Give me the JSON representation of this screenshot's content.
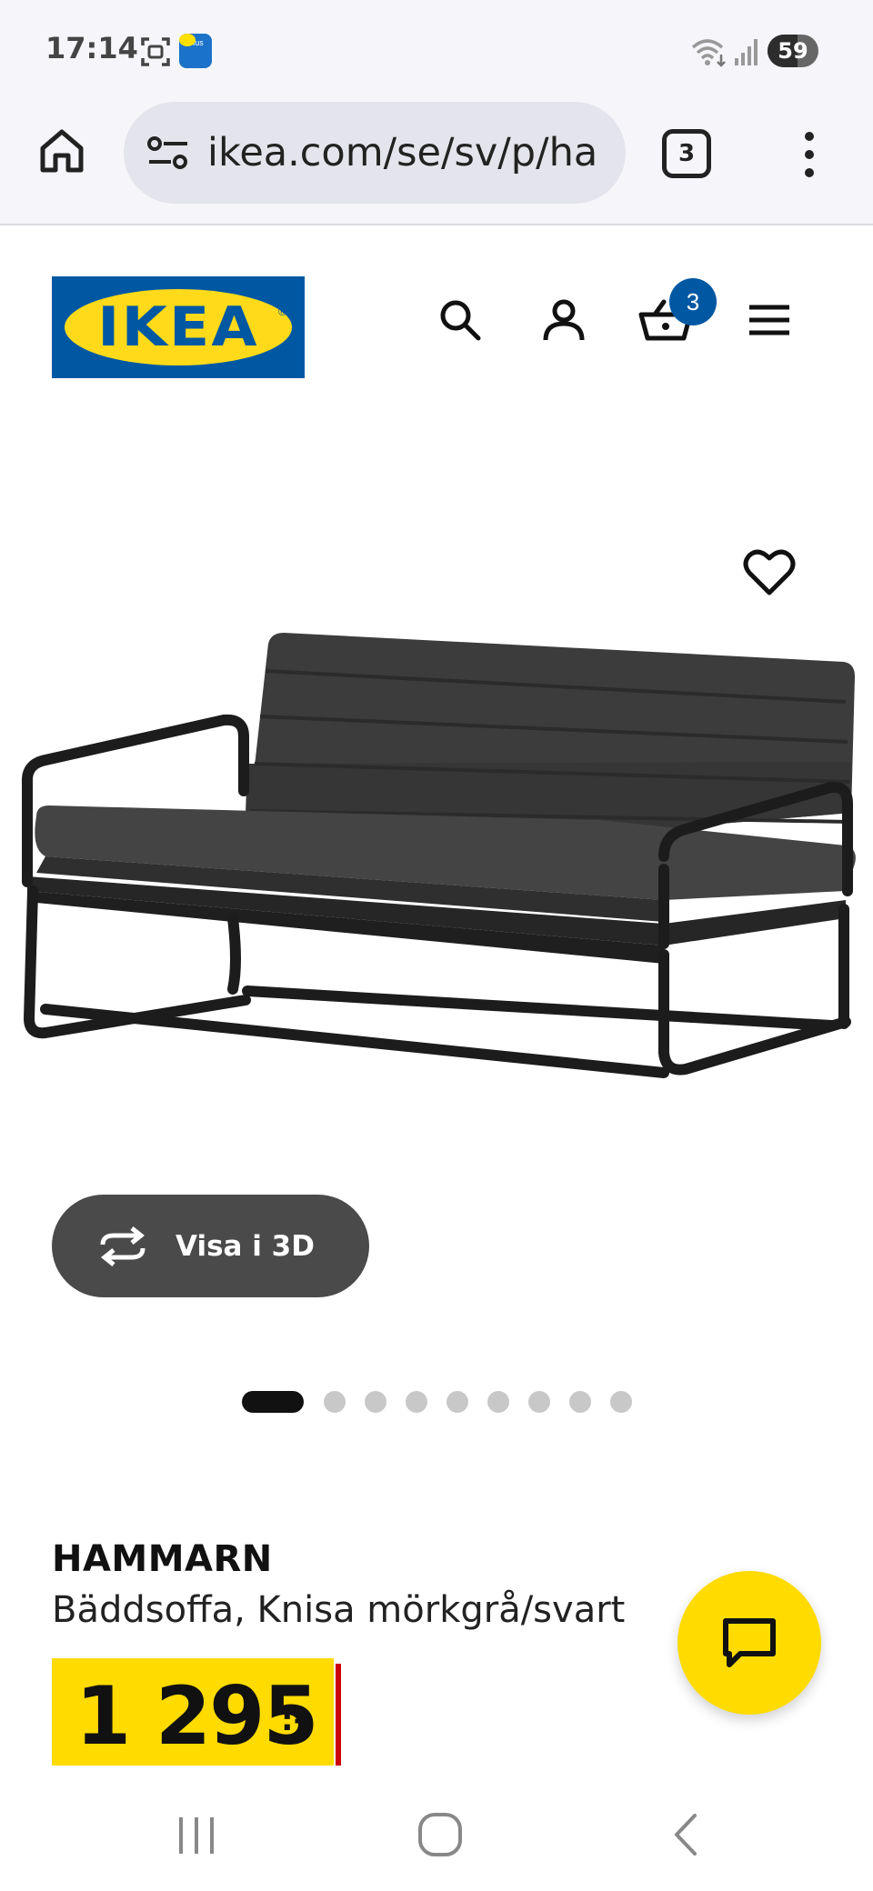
{
  "status_bar": {
    "time": "17:14",
    "battery_level": "59",
    "app_icon_label": "Plus",
    "icons": [
      "screenshot-icon",
      "app-icon",
      "wifi-icon",
      "signal-icon",
      "battery-icon"
    ]
  },
  "browser": {
    "url": "ikea.com/se/sv/p/ha",
    "tab_count": "3",
    "icons": [
      "home-icon",
      "tune-icon",
      "tabs-icon",
      "more-vert-icon"
    ]
  },
  "site_header": {
    "logo_text": "IKEA",
    "cart_count": "3",
    "brand_blue": "#0058a3",
    "brand_yellow": "#ffda1a",
    "icons": [
      "search-icon",
      "account-icon",
      "cart-icon",
      "hamburger-icon"
    ]
  },
  "product_media": {
    "view_3d_label": "Visa i 3D",
    "carousel_total": 9,
    "carousel_active": 1,
    "icons": [
      "heart-icon",
      "rotate-3d-icon"
    ]
  },
  "product": {
    "name": "HAMMARN",
    "description": "Bäddsoffa, Knisa mörkgrå/svart",
    "price_integer": "1 295",
    "price_suffix": ":-",
    "price_color": "#ffdb00"
  },
  "chat": {
    "icon": "chat-icon"
  },
  "nav_bar": {
    "icons": [
      "recents-icon",
      "home-nav-icon",
      "back-icon"
    ]
  }
}
